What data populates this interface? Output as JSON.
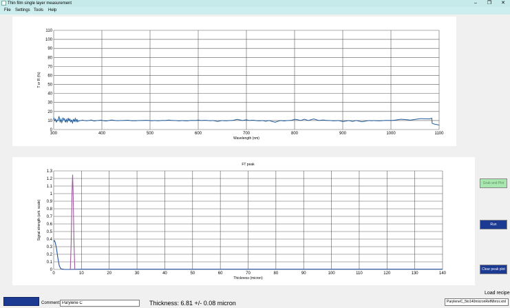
{
  "window": {
    "title": "Thin film single layer measurement",
    "minimize": "–",
    "maximize": "❐",
    "close": "✕"
  },
  "menu": [
    "File",
    "Settings",
    "Tools",
    "Help"
  ],
  "chart_data": [
    {
      "type": "line",
      "title": "",
      "xlabel": "Wavelength (nm)",
      "ylabel": "T or R (%)",
      "xlim": [
        300,
        1100
      ],
      "ylim": [
        0,
        110
      ],
      "xticks": [
        300,
        400,
        500,
        600,
        700,
        800,
        900,
        1000,
        1100
      ],
      "yticks": [
        0,
        10,
        20,
        30,
        40,
        50,
        60,
        70,
        80,
        90,
        100,
        110
      ],
      "grid": true,
      "color": "#1f5b9c",
      "series": [
        {
          "x": [
            300,
            305,
            310,
            315,
            320,
            325,
            330,
            335,
            340,
            345,
            350,
            360,
            370,
            380,
            390,
            400,
            420,
            440,
            460,
            480,
            500,
            520,
            540,
            560,
            580,
            600,
            620,
            640,
            660,
            680,
            700,
            720,
            740,
            760,
            780,
            800,
            820,
            840,
            860,
            880,
            900,
            920,
            940,
            960,
            980,
            1000,
            1020,
            1040,
            1060,
            1080,
            1090,
            1100
          ],
          "y": [
            13,
            9,
            14,
            10,
            13,
            9,
            12,
            10,
            12,
            9,
            11,
            9.5,
            10.5,
            9,
            10,
            9.5,
            9.5,
            10,
            9.5,
            10,
            9.5,
            10.5,
            9.5,
            10.5,
            9,
            10.5,
            9,
            11,
            9,
            11.5,
            9,
            12,
            9,
            12,
            8.5,
            12.5,
            8.5,
            12,
            8.5,
            11.5,
            8.5,
            11,
            8.5,
            10.5,
            8,
            10,
            8,
            9.5,
            8,
            8,
            6,
            5
          ]
        }
      ]
    },
    {
      "type": "line",
      "title": "FT peak",
      "xlabel": "Thickness (micron)",
      "ylabel": "Signal strength (arb. scale)",
      "xlim": [
        0,
        140
      ],
      "ylim": [
        0,
        1.3
      ],
      "xticks": [
        0,
        10,
        20,
        30,
        40,
        50,
        60,
        70,
        80,
        90,
        100,
        110,
        120,
        130,
        140
      ],
      "yticks": [
        0,
        0.1,
        0.2,
        0.3,
        0.4,
        0.5,
        0.6,
        0.7,
        0.8,
        0.9,
        1,
        1.1,
        1.2,
        1.3
      ],
      "grid": true,
      "series": [
        {
          "color": "#1f4fa0",
          "x": [
            0,
            0.3,
            0.6,
            1,
            1.5,
            2,
            2.5,
            3,
            4,
            5,
            10,
            20,
            30,
            40,
            50,
            60,
            70,
            80,
            90,
            100,
            110,
            120,
            130,
            140
          ],
          "y": [
            0.37,
            0.38,
            0.35,
            0.28,
            0.15,
            0.05,
            0.01,
            0.005,
            0,
            0,
            0.003,
            0.003,
            0.003,
            0.003,
            0.003,
            0.003,
            0.003,
            0.003,
            0.003,
            0.003,
            0.003,
            0.003,
            0.003,
            0.003
          ]
        },
        {
          "color": "#9b5a9b",
          "x": [
            6,
            6.3,
            6.6,
            6.81,
            7.0,
            7.3,
            7.6
          ],
          "y": [
            0,
            0.35,
            1.0,
            1.25,
            1.0,
            0.35,
            0
          ]
        }
      ]
    }
  ],
  "buttons": {
    "plot": "Grab and Plot",
    "run": "Run",
    "clear": "Clear peak plot",
    "bottom": ""
  },
  "comment": {
    "label": "Comment:",
    "value": "Parylene C"
  },
  "thickness_text": "Thickness: 6.81 +/- 0.08 micron",
  "recipe": {
    "label": "Load recipe",
    "selected": "ParyleneC_5to140micronRefMirror.xml"
  }
}
